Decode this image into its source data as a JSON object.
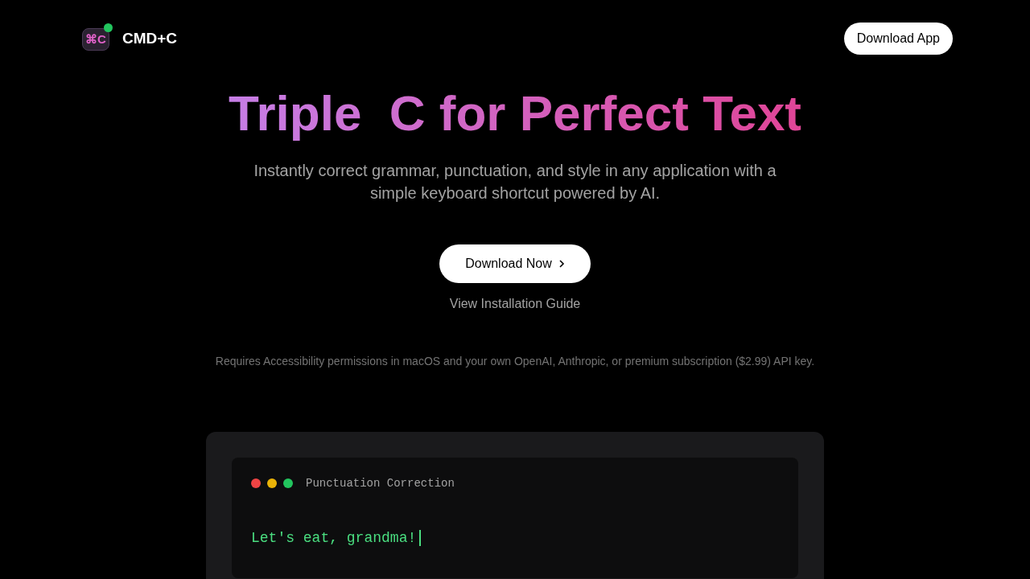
{
  "header": {
    "logo": {
      "glyph": "⌘C",
      "verified": true
    },
    "brand": "CMD+C",
    "download_button": "Download App"
  },
  "hero": {
    "title": "Triple  C for Perfect Text",
    "subtitle": "Instantly correct grammar, punctuation, and style in any application with a simple keyboard shortcut powered by AI.",
    "primary_button": "Download Now",
    "guide_link": "View Installation Guide",
    "requirements": "Requires Accessibility permissions in macOS and your own OpenAI, Anthropic, or premium subscription ($2.99) API key."
  },
  "demo": {
    "window_dots": [
      {
        "color": "#ef4444"
      },
      {
        "color": "#eab308"
      },
      {
        "color": "#22c55e"
      }
    ],
    "title": "Punctuation Correction",
    "text": "Let's eat, grandma!",
    "cursor": true
  }
}
